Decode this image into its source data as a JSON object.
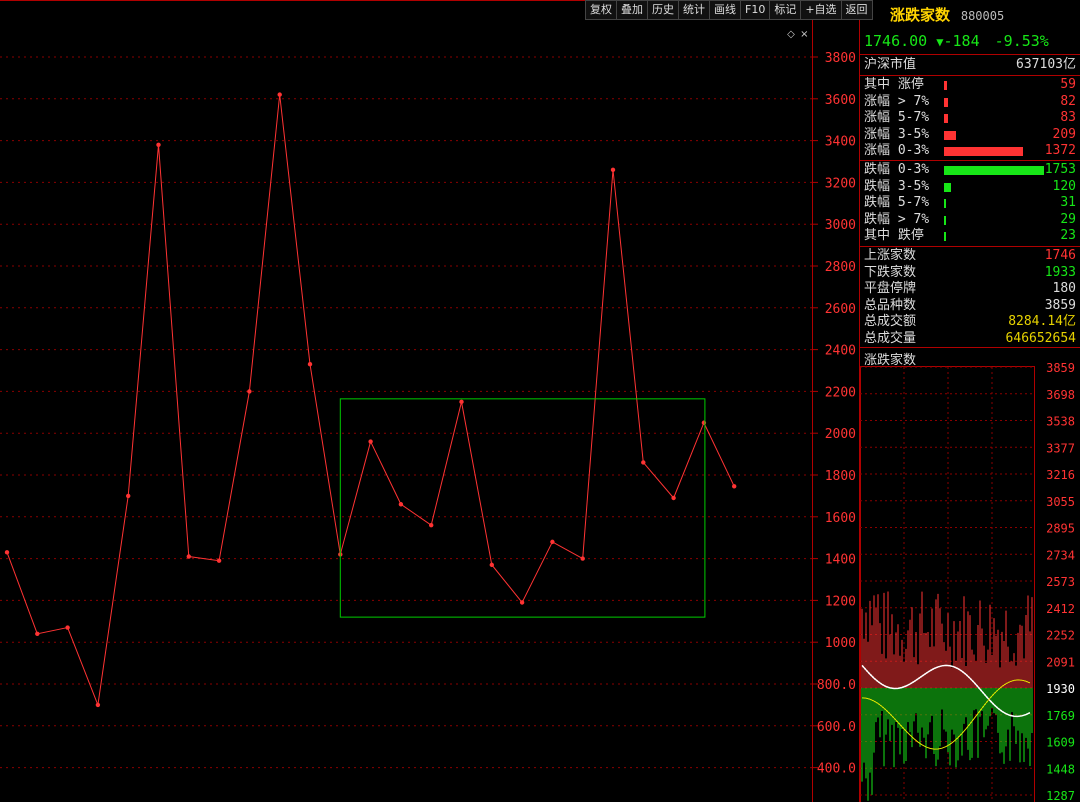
{
  "toolbar": [
    "复权",
    "叠加",
    "历史",
    "统计",
    "画线",
    "F10",
    "标记",
    "+自选",
    "返回"
  ],
  "main_chart_marks": {
    "diamond": "◇",
    "close": "×"
  },
  "chart_data": {
    "type": "line",
    "y_ticks": [
      "3800",
      "3600",
      "3400",
      "3200",
      "3000",
      "2800",
      "2600",
      "2400",
      "2200",
      "2000",
      "1800",
      "1600",
      "1400",
      "1200",
      "1000",
      "800.0",
      "600.0",
      "400.0"
    ],
    "ylim": [
      300,
      3850
    ],
    "values": [
      1430,
      1040,
      1070,
      700,
      1700,
      3380,
      1410,
      1390,
      2200,
      3620,
      2330,
      1420,
      1960,
      1660,
      1560,
      2150,
      1370,
      1190,
      1480,
      1400,
      3260,
      1860,
      1690,
      2050,
      1746
    ],
    "line_color": "#ff3333",
    "box_color": "#00cc00"
  },
  "panel": {
    "title": "涨跌家数",
    "code": "880005",
    "price": "1746.00",
    "arrow": "▼",
    "change": "-184",
    "pct": "-9.53%",
    "market_cap_label": "沪深市值",
    "market_cap_value": "637103亿",
    "rise_rows": [
      {
        "label": "其中  涨停",
        "value": "59",
        "fraction": 0.02
      },
      {
        "label": "涨幅 > 7%",
        "value": "82",
        "fraction": 0.03
      },
      {
        "label": "涨幅 5-7%",
        "value": "83",
        "fraction": 0.03
      },
      {
        "label": "涨幅 3-5%",
        "value": "209",
        "fraction": 0.09
      },
      {
        "label": "涨幅 0-3%",
        "value": "1372",
        "fraction": 0.59
      }
    ],
    "fall_rows": [
      {
        "label": "跌幅 0-3%",
        "value": "1753",
        "fraction": 0.75
      },
      {
        "label": "跌幅 3-5%",
        "value": "120",
        "fraction": 0.05
      },
      {
        "label": "跌幅 5-7%",
        "value": "31",
        "fraction": 0.01
      },
      {
        "label": "跌幅 > 7%",
        "value": "29",
        "fraction": 0.01
      },
      {
        "label": "其中  跌停",
        "value": "23",
        "fraction": 0.01
      }
    ],
    "stats": [
      {
        "label": "上涨家数",
        "value": "1746",
        "color": "#ff3333"
      },
      {
        "label": "下跌家数",
        "value": "1933",
        "color": "#17e617"
      },
      {
        "label": "平盘停牌",
        "value": "180",
        "color": "#dddddd"
      },
      {
        "label": "总品种数",
        "value": "3859",
        "color": "#dddddd"
      },
      {
        "label": "总成交额",
        "value": "8284.14亿",
        "color": "#e6d200"
      },
      {
        "label": "总成交量",
        "value": "646652654",
        "color": "#e6d200"
      }
    ],
    "mini_title": "涨跌家数",
    "mini_ticks": [
      {
        "v": "3859",
        "c": "#ff3333"
      },
      {
        "v": "3698",
        "c": "#ff3333"
      },
      {
        "v": "3538",
        "c": "#ff3333"
      },
      {
        "v": "3377",
        "c": "#ff3333"
      },
      {
        "v": "3216",
        "c": "#ff3333"
      },
      {
        "v": "3055",
        "c": "#ff3333"
      },
      {
        "v": "2895",
        "c": "#ff3333"
      },
      {
        "v": "2734",
        "c": "#ff3333"
      },
      {
        "v": "2573",
        "c": "#ff3333"
      },
      {
        "v": "2412",
        "c": "#ff3333"
      },
      {
        "v": "2252",
        "c": "#ff3333"
      },
      {
        "v": "2091",
        "c": "#ff3333"
      },
      {
        "v": "1930",
        "c": "#ffffff"
      },
      {
        "v": "1769",
        "c": "#17e617"
      },
      {
        "v": "1609",
        "c": "#17e617"
      },
      {
        "v": "1448",
        "c": "#17e617"
      },
      {
        "v": "1287",
        "c": "#17e617"
      }
    ]
  }
}
